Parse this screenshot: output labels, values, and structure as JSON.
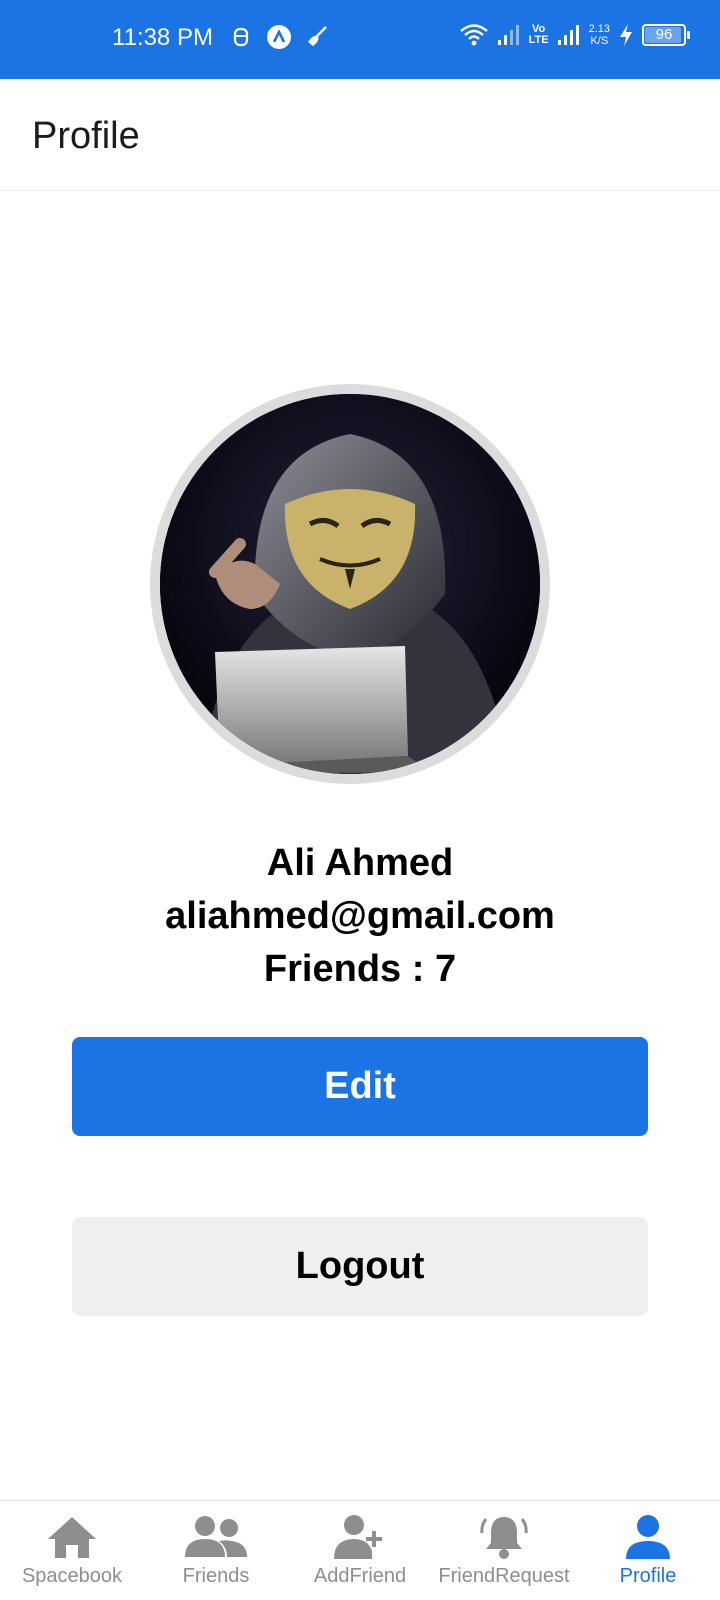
{
  "status_bar": {
    "time": "11:38 PM",
    "volte_top": "Vo",
    "volte_bottom": "LTE",
    "speed_value": "2.13",
    "speed_unit": "K/S",
    "battery": "96",
    "battery_level": 0.96
  },
  "header": {
    "title": "Profile"
  },
  "profile": {
    "name": "Ali Ahmed",
    "email": "aliahmed@gmail.com",
    "friends": "Friends : 7"
  },
  "actions": {
    "edit_label": "Edit",
    "logout_label": "Logout"
  },
  "bottom_nav": {
    "items": [
      {
        "label": "Spacebook",
        "icon": "home-icon"
      },
      {
        "label": "Friends",
        "icon": "people-icon"
      },
      {
        "label": "AddFriend",
        "icon": "add-person-icon"
      },
      {
        "label": "FriendRequest",
        "icon": "bell-icon"
      },
      {
        "label": "Profile",
        "icon": "person-icon"
      }
    ],
    "active": "Profile"
  },
  "colors": {
    "primary": "#1c74e4",
    "inactive": "#8e8e8e",
    "secondary_button": "#efefef"
  }
}
